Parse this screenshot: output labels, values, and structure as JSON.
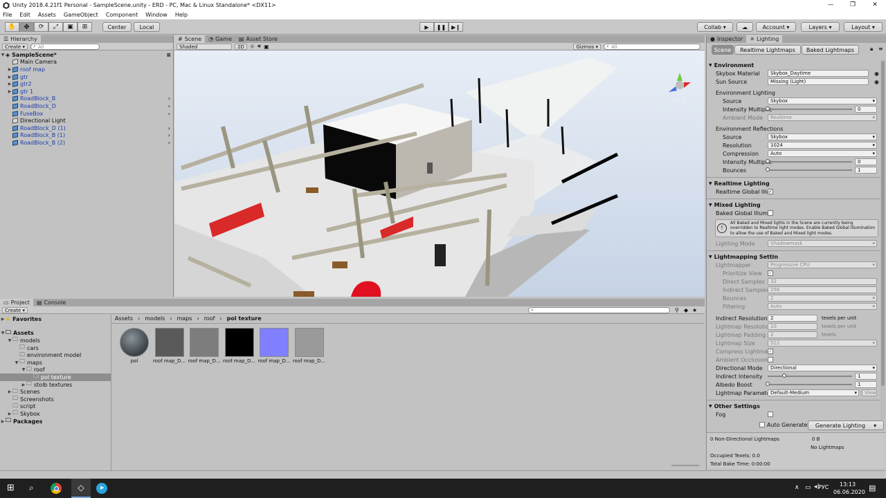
{
  "window": {
    "title": "Unity 2018.4.21f1 Personal - SampleScene.unity - ERD - PC, Mac & Linux Standalone* <DX11>",
    "minimize": "—",
    "maximize": "❐",
    "close": "✕"
  },
  "menu": [
    "File",
    "Edit",
    "Assets",
    "GameObject",
    "Component",
    "Window",
    "Help"
  ],
  "toolbar": {
    "pivot_label": "Center",
    "space_label": "Local",
    "collab_label": "Collab ▾",
    "account_label": "Account ▾",
    "layers_label": "Layers ▾",
    "layout_label": "Layout ▾"
  },
  "hierarchy": {
    "tab_label": "Hierarchy",
    "create_label": "Create ▾",
    "search_placeholder": "All",
    "scene_name": "SampleScene*",
    "items": [
      {
        "label": "Main Camera",
        "prefab": false,
        "expandable": false
      },
      {
        "label": "roof map",
        "prefab": true,
        "expandable": true
      },
      {
        "label": "gtr",
        "prefab": true,
        "expandable": true
      },
      {
        "label": "gtr2",
        "prefab": true,
        "expandable": true
      },
      {
        "label": "gtr 1",
        "prefab": true,
        "expandable": true
      },
      {
        "label": "RoadBlock_B",
        "prefab": true,
        "expandable": false
      },
      {
        "label": "RoadBlock_D",
        "prefab": true,
        "expandable": false
      },
      {
        "label": "FuseBox",
        "prefab": true,
        "expandable": false
      },
      {
        "label": "Directional Light",
        "prefab": false,
        "expandable": false
      },
      {
        "label": "RoadBlock_D (1)",
        "prefab": true,
        "expandable": false
      },
      {
        "label": "RoadBlock_B (1)",
        "prefab": true,
        "expandable": false
      },
      {
        "label": "RoadBlock_B (2)",
        "prefab": true,
        "expandable": false
      }
    ]
  },
  "scene": {
    "tabs": [
      "Scene",
      "Game",
      "Asset Store"
    ],
    "shading_label": "Shaded",
    "mode_2d": "2D",
    "gizmos_label": "Gizmos ▾",
    "search_placeholder": "All",
    "persp_label": "Persp"
  },
  "project": {
    "tabs": [
      "Project",
      "Console"
    ],
    "create_label": "Create ▾",
    "favorites_label": "Favorites",
    "assets_label": "Assets",
    "packages_label": "Packages",
    "tree": [
      "models",
      "cars",
      "environment model",
      "maps",
      "roof",
      "pol texture",
      "stolb textures",
      "Scenes",
      "Screenshots",
      "script",
      "Skybox"
    ],
    "breadcrumb": [
      "Assets",
      "models",
      "maps",
      "roof",
      "pol texture"
    ],
    "thumbnails": [
      {
        "label": "pol",
        "color": "#4b5359"
      },
      {
        "label": "roof map_D...",
        "color": "#5a5a5a"
      },
      {
        "label": "roof map_D...",
        "color": "#7d7d7d"
      },
      {
        "label": "roof map_D...",
        "color": "#000000"
      },
      {
        "label": "roof map_D...",
        "color": "#7f7fff"
      },
      {
        "label": "roof map_D...",
        "color": "#9a9a9a"
      }
    ]
  },
  "inspector": {
    "tabs": [
      "Inspector",
      "Lighting"
    ],
    "sub_tabs": [
      "Scene",
      "Realtime Lightmaps",
      "Baked Lightmaps"
    ],
    "environment": {
      "title": "Environment",
      "skybox_label": "Skybox Material",
      "skybox_value": "Skybox_Daytime",
      "sun_label": "Sun Source",
      "sun_value": "Missing (Light)",
      "env_lighting": "Environment Lighting",
      "source_label": "Source",
      "source_value": "Skybox",
      "intensity_label": "Intensity Multiplie",
      "intensity_value": "0",
      "ambient_label": "Ambient Mode",
      "ambient_value": "Realtime",
      "env_reflections": "Environment Reflections",
      "refl_source_label": "Source",
      "refl_source_value": "Skybox",
      "resolution_label": "Resolution",
      "resolution_value": "1024",
      "compression_label": "Compression",
      "compression_value": "Auto",
      "refl_intensity_label": "Intensity Multiplie",
      "refl_intensity_value": "0",
      "bounces_label": "Bounces",
      "bounces_value": "1"
    },
    "realtime": {
      "title": "Realtime Lighting",
      "gi_label": "Realtime Global Illu"
    },
    "mixed": {
      "title": "Mixed Lighting",
      "baked_gi_label": "Baked Global Illumi",
      "help_text": "All Baked and Mixed lights in the Scene are currently being overridden to Realtime light modes. Enable Baked Global Illumination to allow the use of Baked and Mixed light modes.",
      "lighting_mode_label": "Lighting Mode",
      "lighting_mode_value": "Shadowmask"
    },
    "lightmapping": {
      "title": "Lightmapping Settin",
      "lightmapper_label": "Lightmapper",
      "lightmapper_value": "Progressive CPU",
      "prioritize_label": "Prioritize View",
      "direct_label": "Direct Samples",
      "direct_value": "32",
      "indirect_label": "Indirect Samples",
      "indirect_value": "256",
      "bounces_label": "Bounces",
      "bounces_value": "2",
      "filtering_label": "Filtering",
      "filtering_value": "Auto",
      "ind_res_label": "Indirect Resolution",
      "ind_res_value": "2",
      "texels_unit": "texels per unit",
      "lm_res_label": "Lightmap Resolutio",
      "lm_res_value": "10",
      "padding_label": "Lightmap Padding",
      "padding_value": "2",
      "texels": "texels",
      "size_label": "Lightmap Size",
      "size_value": "512",
      "compress_label": "Compress Lightmap",
      "ao_label": "Ambient Occlusion",
      "dir_mode_label": "Directional Mode",
      "dir_mode_value": "Directional",
      "ind_int_label": "Indirect Intensity",
      "ind_int_value": "1",
      "albedo_label": "Albedo Boost",
      "albedo_value": "1",
      "params_label": "Lightmap Paramete",
      "params_value": "Default-Medium",
      "view_label": "View"
    },
    "other": {
      "title": "Other Settings",
      "fog_label": "Fog"
    },
    "auto_generate_label": "Auto Generate",
    "generate_label": "Generate Lighting",
    "stats": {
      "nondirectional": "0 Non-Directional Lightmaps",
      "size": "0 B",
      "no_lightmaps": "No Lightmaps",
      "occupied": "Occupied Texels: 0.0",
      "bake_time": "Total Bake Time: 0:00:00"
    }
  },
  "taskbar": {
    "lang": "РУС",
    "time": "13:13",
    "date": "06.06.2020"
  }
}
